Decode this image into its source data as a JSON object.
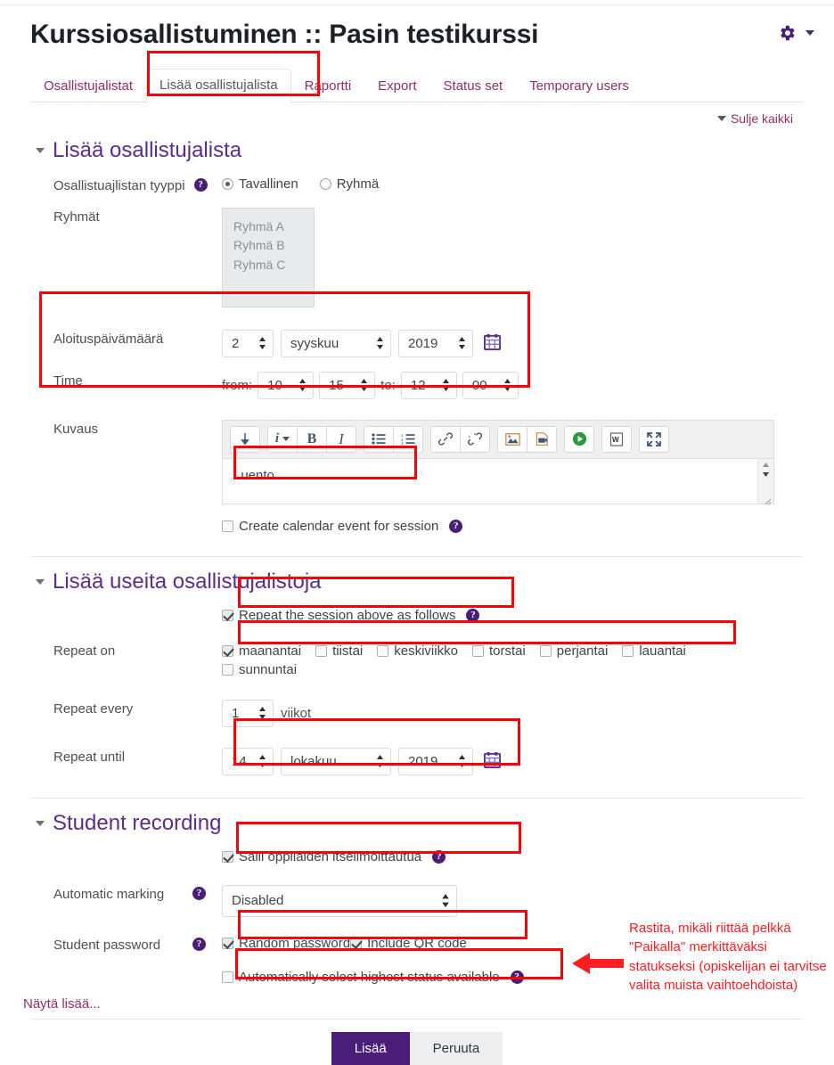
{
  "header": {
    "title": "Kurssiosallistuminen :: Pasin testikurssi",
    "gear_icon": "gear-icon",
    "caret_icon": "chevron-down-icon"
  },
  "tabs": [
    {
      "label": "Osallistujalistat",
      "active": false
    },
    {
      "label": "Lisää osallistujalista",
      "active": true
    },
    {
      "label": "Raportti",
      "active": false
    },
    {
      "label": "Export",
      "active": false
    },
    {
      "label": "Status set",
      "active": false
    },
    {
      "label": "Temporary users",
      "active": false
    }
  ],
  "collapse_all": "Sulje kaikki",
  "sections": {
    "add_session": {
      "title": "Lisää osallistujalista",
      "type_label": "Osallistuajlistan tyyppi",
      "type_options": [
        {
          "label": "Tavallinen",
          "selected": true
        },
        {
          "label": "Ryhmä",
          "selected": false
        }
      ],
      "groups_label": "Ryhmät",
      "groups": [
        "Ryhmä A",
        "Ryhmä B",
        "Ryhmä C"
      ],
      "start_date_label": "Aloituspäivämäärä",
      "start_day": "2",
      "start_month": "syyskuu",
      "start_year": "2019",
      "time_label": "Time",
      "time_from_prefix": "from:",
      "time_from_hour": "10",
      "time_from_min": "15",
      "time_to_prefix": "to:",
      "time_to_hour": "12",
      "time_to_min": "00",
      "description_label": "Kuvaus",
      "description_value": "Luento",
      "calendar_checkbox": "Create calendar event for session"
    },
    "multiple_sessions": {
      "title": "Lisää useita osallistujalistoja",
      "repeat_session_checkbox": "Repeat the session above as follows",
      "repeat_session_checked": true,
      "repeat_on_label": "Repeat on",
      "days": [
        {
          "label": "maanantai",
          "checked": true
        },
        {
          "label": "tiistai",
          "checked": false
        },
        {
          "label": "keskiviikko",
          "checked": false
        },
        {
          "label": "torstai",
          "checked": false
        },
        {
          "label": "perjantai",
          "checked": false
        },
        {
          "label": "lauantai",
          "checked": false
        },
        {
          "label": "sunnuntai",
          "checked": false
        }
      ],
      "repeat_every_label": "Repeat every",
      "repeat_every_value": "1",
      "repeat_every_unit": "viikot",
      "repeat_until_label": "Repeat until",
      "until_day": "14",
      "until_month": "lokakuu",
      "until_year": "2019"
    },
    "student_recording": {
      "title": "Student recording",
      "self_enrol_checkbox": "Salli oppilaiden itseilmoittautua",
      "self_enrol_checked": true,
      "automatic_marking_label": "Automatic marking",
      "automatic_marking_value": "Disabled",
      "student_password_label": "Student password",
      "random_password_checkbox": "Random password",
      "random_password_checked": true,
      "include_qr_checkbox": "Include QR code",
      "include_qr_checked": true,
      "auto_highest_checkbox": "Automatically select highest status available",
      "auto_highest_checked": false
    }
  },
  "show_more": "Näytä lisää...",
  "buttons": {
    "submit": "Lisää",
    "cancel": "Peruuta"
  },
  "annotation": "Rastita, mikäli riittää pelkkä \"Paikalla\" merkittäväksi statukseksi (opiskelijan ei tarvitse valita muista vaihtoehdoista)",
  "colors": {
    "accent_purple": "#4a1e78",
    "link_magenta": "#8e2f6b",
    "section_heading": "#5b2d8e",
    "highlight_red": "#fb0007"
  }
}
